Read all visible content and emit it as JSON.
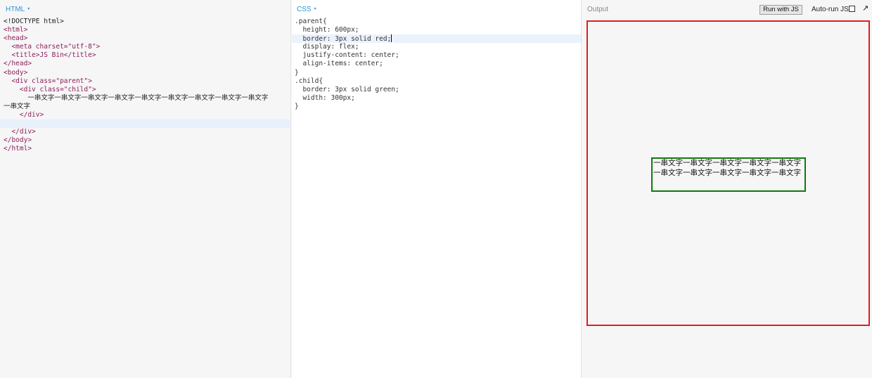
{
  "panels": {
    "html": {
      "title": "HTML",
      "caret": "▾"
    },
    "css": {
      "title": "CSS",
      "caret": "▾"
    },
    "output": {
      "title": "Output"
    }
  },
  "html_code": [
    "<!DOCTYPE html>",
    "<html>",
    "<head>",
    "  <meta charset=\"utf-8\">",
    "  <title>JS Bin</title>",
    "</head>",
    "<body>",
    "  <div class=\"parent\">",
    "    <div class=\"child\">",
    "      一串文字一串文字一串文字一串文字一串文字一串文字一串文字一串文字一串文字",
    "一串文字",
    "    </div>",
    "",
    "  </div>",
    "</body>",
    "</html>"
  ],
  "css_code": [
    ".parent{",
    "  height: 600px;",
    "  border: 3px solid red;",
    "  display: flex;",
    "  justify-content: center;",
    "  align-items: center;",
    "}",
    ".child{",
    "  border: 3px solid green;",
    "  width: 300px;",
    "}"
  ],
  "output": {
    "run_button": "Run with JS",
    "autorun_label": "Auto-run JS",
    "popout_icon": "↗",
    "child_text": "一串文字一串文字一串文字一串文字一串文字一串文字一串文字一串文字一串文字一串文字"
  },
  "colors": {
    "accent": "#2d91d6",
    "parent_border": "#e31d1d",
    "child_border": "#0f7a0f"
  }
}
